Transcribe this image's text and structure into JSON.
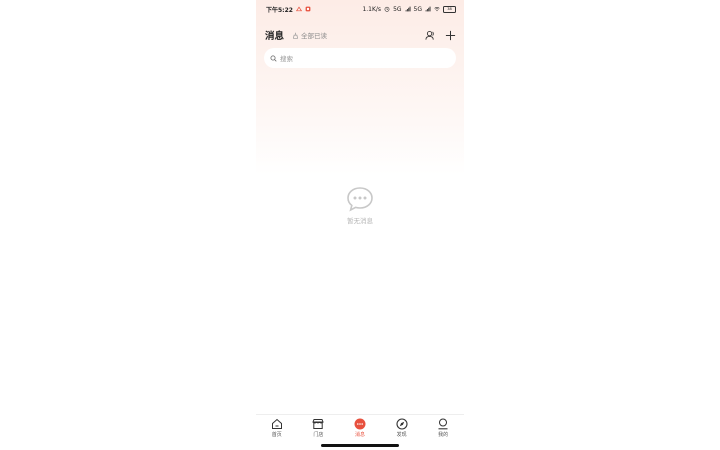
{
  "status_bar": {
    "time": "下午5:22",
    "network_speed": "1.1K/s",
    "signal1": "5G",
    "signal2": "5G",
    "battery": "38"
  },
  "header": {
    "title": "消息",
    "mark_all_read": "全部已读"
  },
  "search": {
    "placeholder": "搜索"
  },
  "empty_state": {
    "text": "暂无消息"
  },
  "tab_bar": {
    "items": [
      {
        "label": "首页",
        "icon": "home-icon"
      },
      {
        "label": "门店",
        "icon": "store-icon"
      },
      {
        "label": "消息",
        "icon": "message-icon"
      },
      {
        "label": "发现",
        "icon": "compass-icon"
      },
      {
        "label": "我的",
        "icon": "profile-icon"
      }
    ],
    "active_index": 2
  },
  "colors": {
    "accent": "#e8513e",
    "empty_icon": "#c8c8c8",
    "header_gradient_top": "#fdece6"
  }
}
